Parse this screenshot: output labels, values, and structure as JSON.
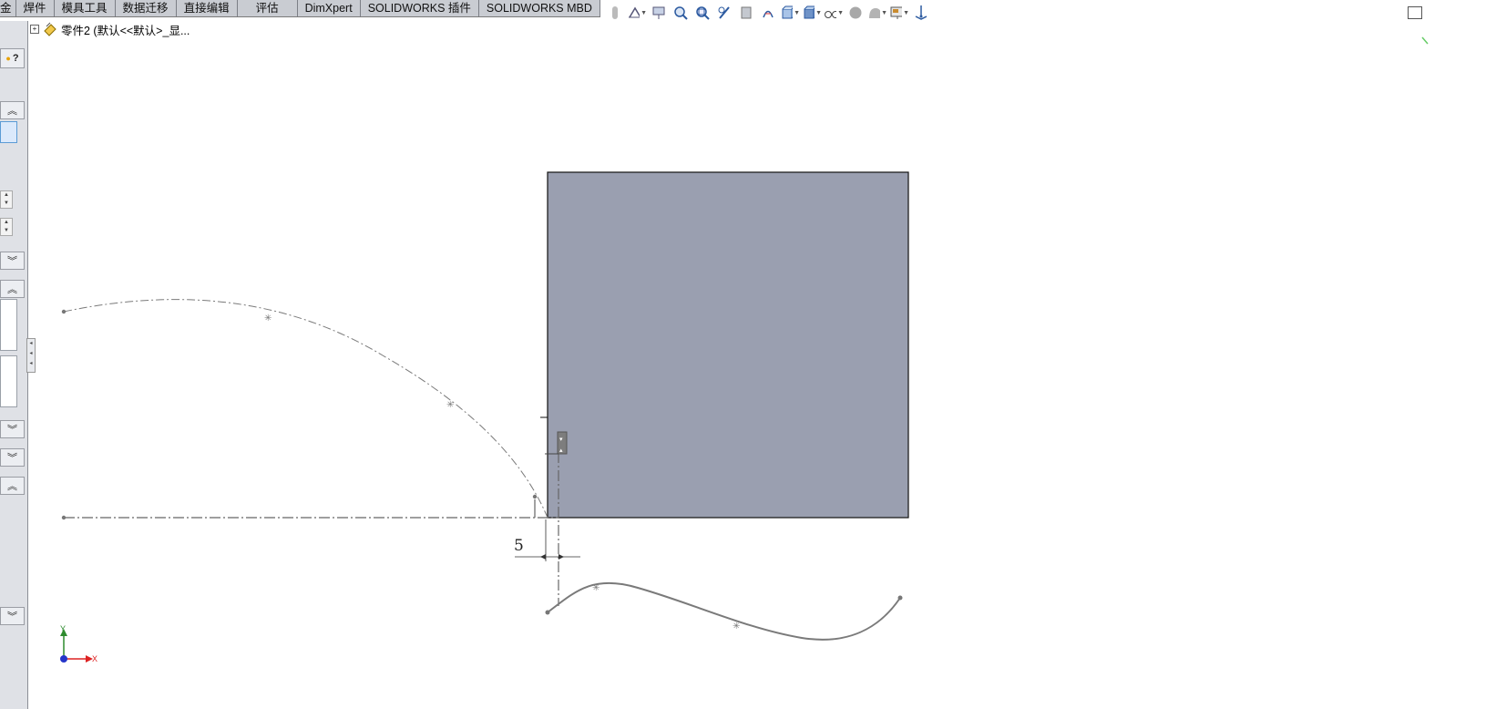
{
  "tabs": [
    {
      "label": "金"
    },
    {
      "label": "焊件"
    },
    {
      "label": "模具工具"
    },
    {
      "label": "数据迁移"
    },
    {
      "label": "直接编辑"
    },
    {
      "label": "评估"
    },
    {
      "label": "DimXpert"
    },
    {
      "label": "SOLIDWORKS 插件"
    },
    {
      "label": "SOLIDWORKS MBD"
    }
  ],
  "toolbar_icons": [
    "view-orientation-icon",
    "zoom-to-fit-icon",
    "zoom-to-area-icon",
    "previous-view-icon",
    "section-view-icon",
    "dynamic-annotation-icon",
    "view-orientation-cube-icon",
    "display-style-icon",
    "hide-show-items-icon",
    "edit-appearance-icon",
    "apply-scene-icon",
    "view-settings-icon",
    "triad-icon"
  ],
  "feature_tree": {
    "part_label": "零件2  (默认<<默认>_显..."
  },
  "left_panel": {
    "help_label": "?"
  },
  "sketch": {
    "dimension_value": "5",
    "axis_x_label": "X",
    "axis_y_label": "Y"
  },
  "colors": {
    "model_face": "#9a9fb0",
    "tab_bg": "#c9ccd2",
    "panel_bg": "#dfe1e6",
    "sketch_line": "#7a7a7a"
  }
}
